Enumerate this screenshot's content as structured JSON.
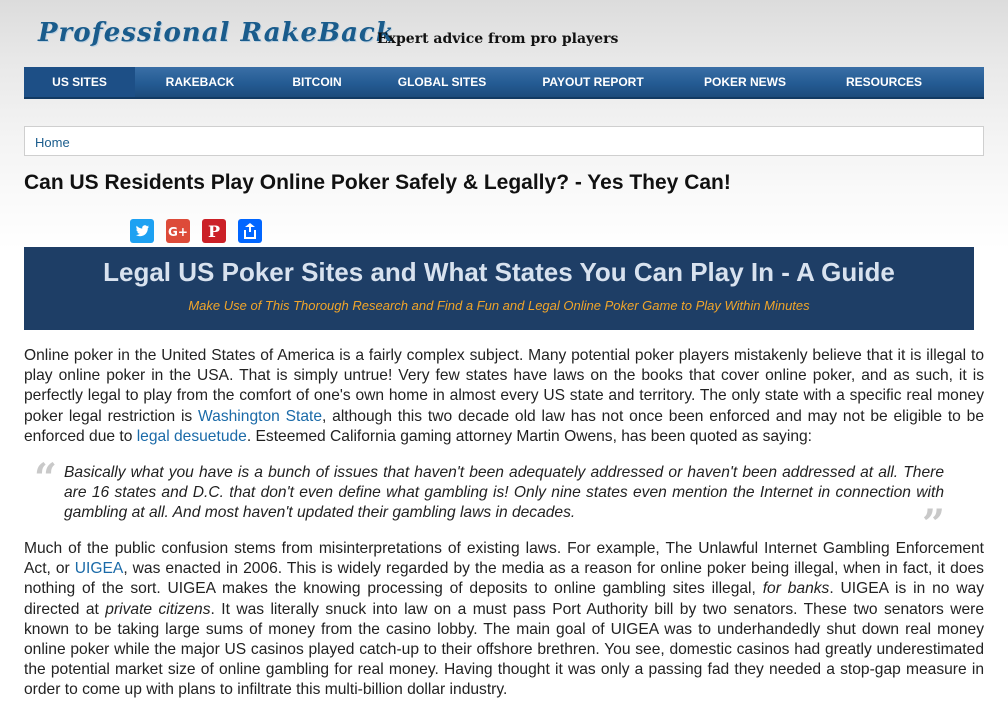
{
  "header": {
    "logo_text": "Professional RakeBack",
    "tagline": "Expert advice from pro players"
  },
  "nav": {
    "items": [
      {
        "label": "US SITES",
        "active": true
      },
      {
        "label": "RAKEBACK"
      },
      {
        "label": "BITCOIN"
      },
      {
        "label": "GLOBAL SITES"
      },
      {
        "label": "PAYOUT REPORT"
      },
      {
        "label": "POKER NEWS"
      },
      {
        "label": "RESOURCES"
      }
    ]
  },
  "breadcrumb": {
    "home": "Home"
  },
  "page_title": "Can US Residents Play Online Poker Safely & Legally? - Yes They Can!",
  "share": {
    "icons": [
      "twitter-icon",
      "google-plus-icon",
      "pinterest-icon",
      "share-icon"
    ],
    "colors": {
      "twitter": "#1da1f2",
      "google_plus": "#dd4b39",
      "pinterest": "#cb2027",
      "share": "#0166ff"
    }
  },
  "banner": {
    "title": "Legal US Poker Sites and What States You Can Play In - A Guide",
    "subtitle": "Make Use of This Thorough Research and Find a Fun and Legal Online Poker Game to Play Within Minutes"
  },
  "para1": {
    "t1": "Online poker in the United States of America is a fairly complex subject. Many potential poker players mistakenly believe that it is illegal to play online poker in the USA. That is simply untrue! Very few states have laws on the books that cover online poker, and as such, it is perfectly legal to play from the comfort of one's own home in almost every US state and territory. The only state with a specific real money poker legal restriction is ",
    "link1": "Washington State",
    "t2": ", although this two decade old law has not once been enforced and may not be eligible to be enforced due to ",
    "link2": "legal desuetude",
    "t3": ". Esteemed California gaming attorney Martin Owens, has been quoted as saying:"
  },
  "quote": {
    "text": "Basically what you have is a bunch of issues that haven't been adequately addressed or haven't been addressed at all. There are 16 states and D.C. that don't even define what gambling is! Only nine states even mention the Internet in connection with gambling at all. And most haven't updated their gambling laws in decades."
  },
  "para2": {
    "t1": "Much of the public confusion stems from misinterpretations of existing laws. For example, The Unlawful Internet Gambling Enforcement Act, or ",
    "link1": "UIGEA",
    "t2": ", was enacted in 2006. This is widely regarded by the media as a reason for online poker being illegal, when in fact, it does nothing of the sort. UIGEA makes the knowing processing of deposits to online gambling sites illegal, ",
    "em1": "for banks",
    "t3": ". UIGEA is in no way directed at ",
    "em2": "private citizens",
    "t4": ". It was literally snuck into law on a must pass Port Authority bill by two senators. These two senators were known to be taking large sums of money from the casino lobby. The main goal of UIGEA was to underhandedly shut down real money online poker while the major US casinos played catch-up to their offshore brethren. You see, domestic casinos had greatly underestimated the potential market size of online gambling for real money. Having thought it was only a passing fad they needed a stop-gap measure in order to come up with plans to infiltrate this multi-billion dollar industry."
  }
}
